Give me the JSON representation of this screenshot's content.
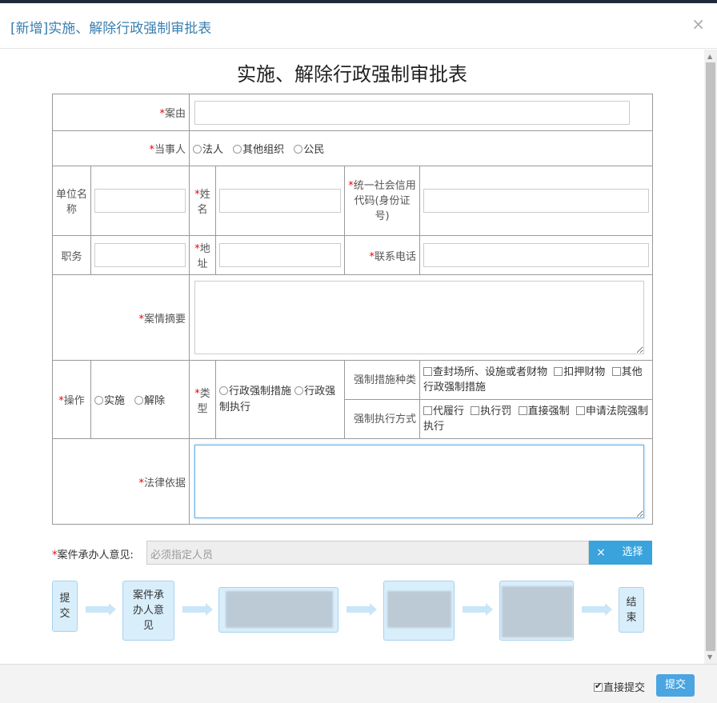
{
  "modal": {
    "title": "[新增]实施、解除行政强制审批表",
    "close": "×"
  },
  "form": {
    "title": "实施、解除行政强制审批表",
    "req_mark": "*",
    "case_reason_label": "案由",
    "party_label": "当事人",
    "party_options": [
      "法人",
      "其他组织",
      "公民"
    ],
    "unit_name_label": "单位名称",
    "name_label": "姓名",
    "credit_code_label": "统一社会信用代码(身份证号)",
    "position_label": "职务",
    "address_label": "地址",
    "phone_label": "联系电话",
    "summary_label": "案情摘要",
    "operation_label": "操作",
    "operation_options": [
      "实施",
      "解除"
    ],
    "type_label": "类型",
    "type_options": [
      "行政强制措施",
      "行政强制执行"
    ],
    "measure_kind_label": "强制措施种类",
    "measure_kind_options": [
      "查封场所、设施或者财物",
      "扣押财物",
      "其他行政强制措施"
    ],
    "exec_mode_label": "强制执行方式",
    "exec_mode_options": [
      "代履行",
      "执行罚",
      "直接强制",
      "申请法院强制执行"
    ],
    "legal_basis_label": "法律依据"
  },
  "handler": {
    "label": "案件承办人意见:",
    "placeholder": "必须指定人员",
    "clear": "×",
    "select": "选择"
  },
  "flow": {
    "nodes": [
      "提交",
      "案件承办人意见",
      "",
      "",
      "",
      "结束"
    ]
  },
  "footer": {
    "direct_submit": "直接提交",
    "submit": "提交"
  }
}
